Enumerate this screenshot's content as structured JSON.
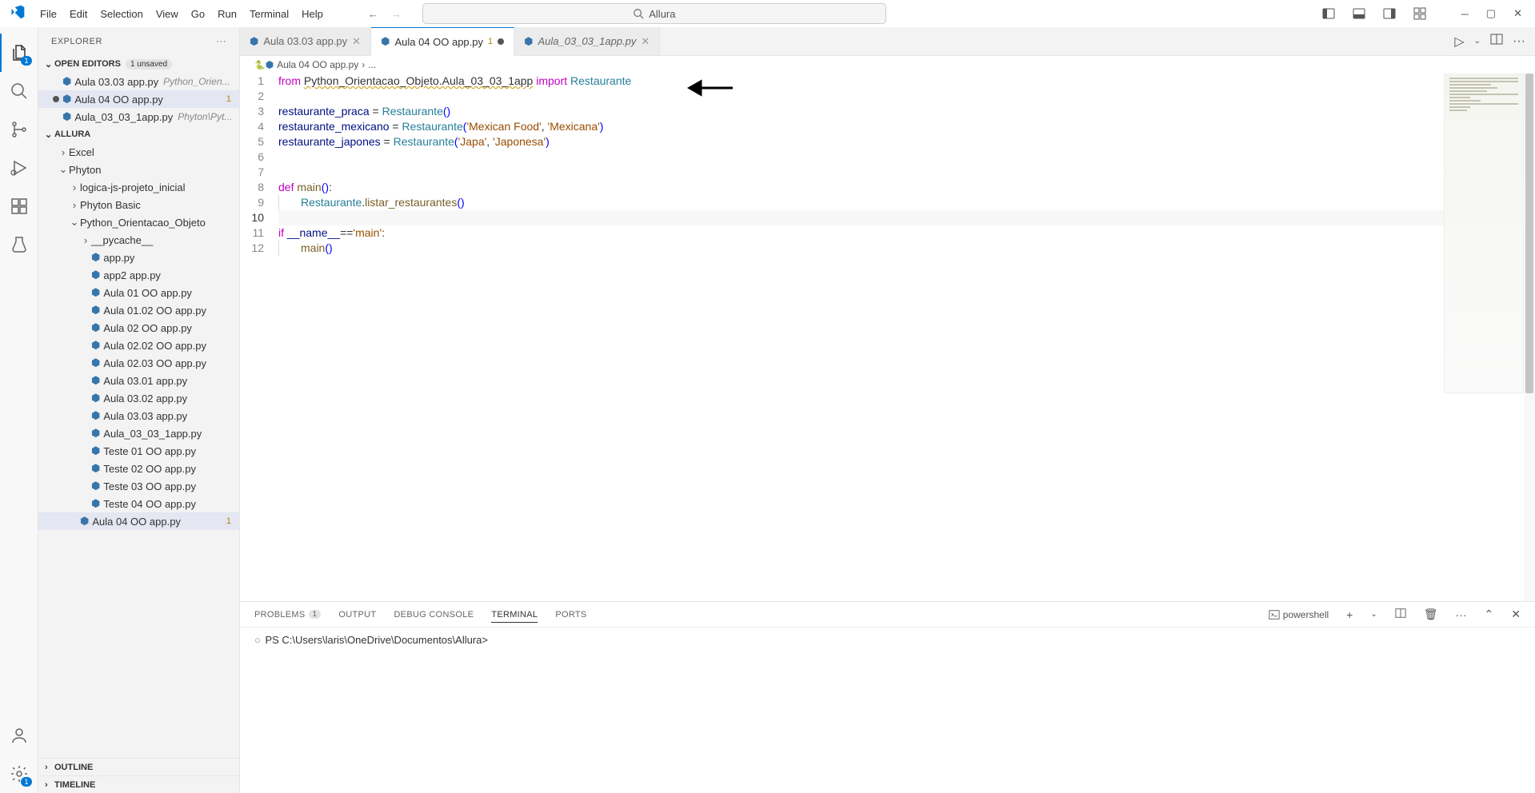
{
  "menu": {
    "items": [
      "File",
      "Edit",
      "Selection",
      "View",
      "Go",
      "Run",
      "Terminal",
      "Help"
    ]
  },
  "search": {
    "text": "Allura"
  },
  "sidebar": {
    "title": "EXPLORER",
    "openEditors": {
      "label": "OPEN EDITORS",
      "unsaved": "1 unsaved",
      "items": [
        {
          "name": "Aula 03.03 app.py",
          "dim": "Python_Orien...",
          "modified": false
        },
        {
          "name": "Aula 04 OO app.py",
          "dim": "",
          "modified": true,
          "num": "1",
          "selected": true
        },
        {
          "name": "Aula_03_03_1app.py",
          "dim": "Phyton\\Pyt...",
          "modified": false
        }
      ]
    },
    "folder": {
      "name": "ALLURA",
      "tree": [
        {
          "depth": 0,
          "chev": ">",
          "label": "Excel",
          "type": "folder"
        },
        {
          "depth": 0,
          "chev": "v",
          "label": "Phyton",
          "type": "folder"
        },
        {
          "depth": 1,
          "chev": ">",
          "label": "logica-js-projeto_inicial",
          "type": "folder"
        },
        {
          "depth": 1,
          "chev": ">",
          "label": "Phyton Basic",
          "type": "folder"
        },
        {
          "depth": 1,
          "chev": "v",
          "label": "Python_Orientacao_Objeto",
          "type": "folder"
        },
        {
          "depth": 2,
          "chev": ">",
          "label": "__pycache__",
          "type": "folder"
        },
        {
          "depth": 2,
          "chev": "",
          "label": "app.py",
          "type": "py"
        },
        {
          "depth": 2,
          "chev": "",
          "label": "app2 app.py",
          "type": "py"
        },
        {
          "depth": 2,
          "chev": "",
          "label": "Aula 01 OO app.py",
          "type": "py"
        },
        {
          "depth": 2,
          "chev": "",
          "label": "Aula 01.02 OO app.py",
          "type": "py"
        },
        {
          "depth": 2,
          "chev": "",
          "label": "Aula 02 OO app.py",
          "type": "py"
        },
        {
          "depth": 2,
          "chev": "",
          "label": "Aula 02.02 OO app.py",
          "type": "py"
        },
        {
          "depth": 2,
          "chev": "",
          "label": "Aula 02.03 OO app.py",
          "type": "py"
        },
        {
          "depth": 2,
          "chev": "",
          "label": "Aula 03.01 app.py",
          "type": "py"
        },
        {
          "depth": 2,
          "chev": "",
          "label": "Aula 03.02 app.py",
          "type": "py"
        },
        {
          "depth": 2,
          "chev": "",
          "label": "Aula 03.03 app.py",
          "type": "py"
        },
        {
          "depth": 2,
          "chev": "",
          "label": "Aula_03_03_1app.py",
          "type": "py"
        },
        {
          "depth": 2,
          "chev": "",
          "label": "Teste 01 OO app.py",
          "type": "py"
        },
        {
          "depth": 2,
          "chev": "",
          "label": "Teste 02 OO app.py",
          "type": "py"
        },
        {
          "depth": 2,
          "chev": "",
          "label": "Teste 03 OO app.py",
          "type": "py"
        },
        {
          "depth": 2,
          "chev": "",
          "label": "Teste 04 OO app.py",
          "type": "py"
        },
        {
          "depth": 1,
          "chev": "",
          "label": "Aula 04 OO app.py",
          "type": "py",
          "selected": true,
          "num": "1"
        }
      ]
    },
    "outline": "OUTLINE",
    "timeline": "TIMELINE"
  },
  "tabs": [
    {
      "label": "Aula 03.03 app.py",
      "active": false,
      "modified": false
    },
    {
      "label": "Aula 04 OO app.py",
      "active": true,
      "modified": true,
      "modnum": "1"
    },
    {
      "label": "Aula_03_03_1app.py",
      "active": false,
      "modified": false,
      "italic": true
    }
  ],
  "breadcrumb": {
    "file": "Aula 04 OO app.py",
    "more": "..."
  },
  "code": {
    "lines": [
      {
        "n": 1,
        "html": "<span class='cl-kw'>from</span> <span class='underline-wavy'>Python_Orientacao_Objeto.Aula_03_03_1app</span> <span class='cl-kw'>import</span> <span class='cl-cls'>Restaurante</span>"
      },
      {
        "n": 2,
        "html": ""
      },
      {
        "n": 3,
        "html": "<span class='cl-var'>restaurante_praca</span> = <span class='cl-cls'>Restaurante</span><span class='cl-par'>()</span>"
      },
      {
        "n": 4,
        "html": "<span class='cl-var'>restaurante_mexicano</span> = <span class='cl-cls'>Restaurante</span><span class='cl-par'>(</span><span class='cl-str'>'Mexican Food'</span>, <span class='cl-str'>'Mexicana'</span><span class='cl-par'>)</span>"
      },
      {
        "n": 5,
        "html": "<span class='cl-var'>restaurante_japones</span> = <span class='cl-cls'>Restaurante</span><span class='cl-par'>(</span><span class='cl-str'>'Japa'</span>, <span class='cl-str'>'Japonesa'</span><span class='cl-par'>)</span>"
      },
      {
        "n": 6,
        "html": ""
      },
      {
        "n": 7,
        "html": ""
      },
      {
        "n": 8,
        "html": "<span class='cl-kw'>def</span> <span class='cl-fn'>main</span><span class='cl-par'>()</span>:"
      },
      {
        "n": 9,
        "html": "<span class='indent-guide'></span><span class='cl-cls'>Restaurante</span>.<span class='cl-fn'>listar_restaurantes</span><span class='cl-par'>()</span>"
      },
      {
        "n": 10,
        "html": "",
        "cur": true
      },
      {
        "n": 11,
        "html": "<span class='cl-kw'>if</span> <span class='cl-var'>__name__</span>==<span class='cl-str'>'main'</span>:"
      },
      {
        "n": 12,
        "html": "<span class='indent-guide'></span><span class='cl-fn'>main</span><span class='cl-par'>()</span>"
      }
    ]
  },
  "panel": {
    "tabs": {
      "problems": "PROBLEMS",
      "problemsCount": "1",
      "output": "OUTPUT",
      "debug": "DEBUG CONSOLE",
      "terminal": "TERMINAL",
      "ports": "PORTS"
    },
    "shell": "powershell",
    "prompt": "PS C:\\Users\\laris\\OneDrive\\Documentos\\Allura>"
  }
}
